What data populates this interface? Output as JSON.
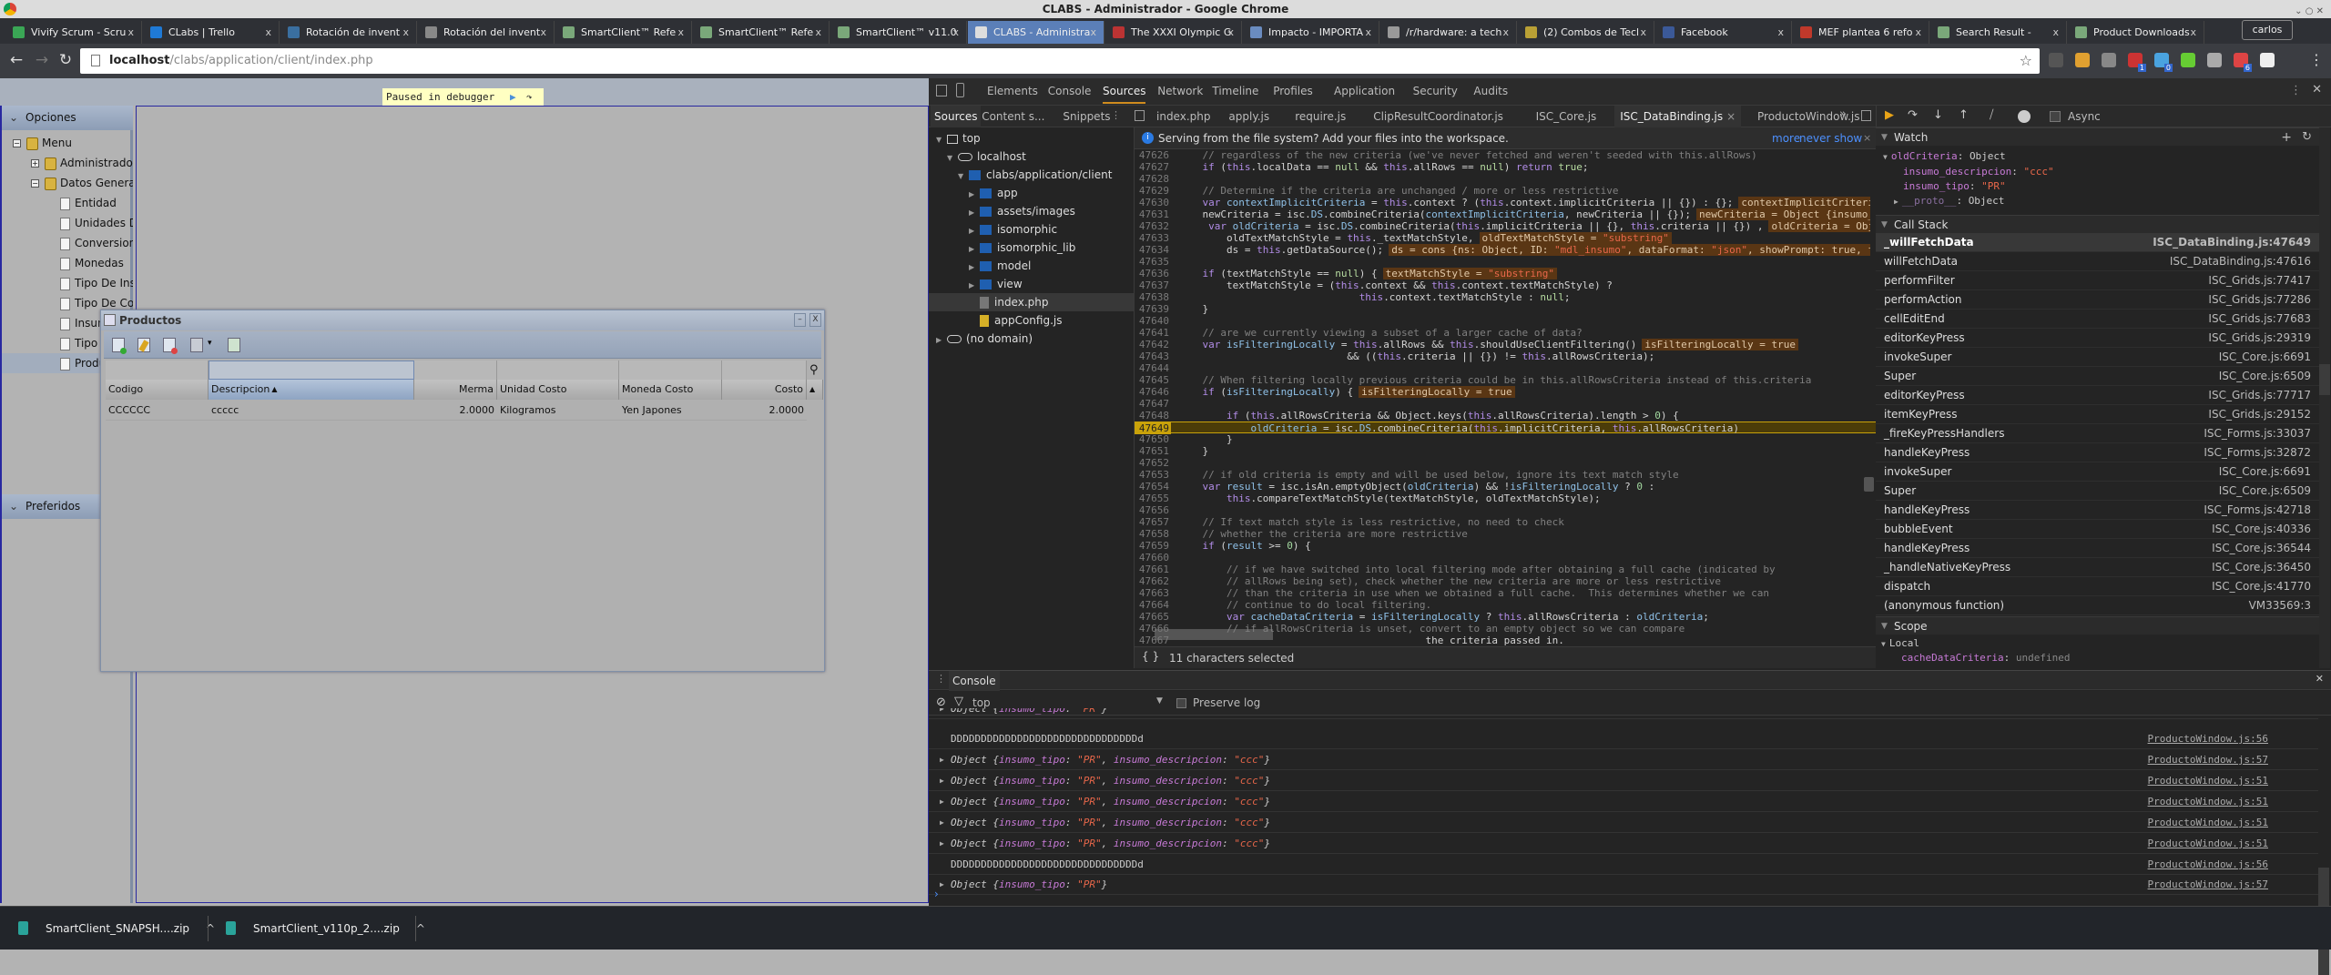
{
  "window_title": "CLABS - Administrador - Google Chrome",
  "browser": {
    "tabs": [
      {
        "label": "Vivify Scrum - Scru",
        "icon": "checkmark-icon",
        "color": "#3aa655"
      },
      {
        "label": "CLabs | Trello",
        "icon": "trello-icon",
        "color": "#1f7ad6"
      },
      {
        "label": "Rotación de invent",
        "icon": "at-icon",
        "color": "#3a6fa0"
      },
      {
        "label": "Rotación del invent",
        "icon": "wikipedia-icon",
        "color": "#888888"
      },
      {
        "label": "SmartClient™ Refe",
        "icon": "smartclient-icon",
        "color": "#7aa87a"
      },
      {
        "label": "SmartClient™ Refe",
        "icon": "smartclient-icon",
        "color": "#7aa87a"
      },
      {
        "label": "SmartClient™ v11.0",
        "icon": "smartclient-icon",
        "color": "#7aa87a"
      },
      {
        "label": "CLABS - Administra",
        "icon": "page-icon",
        "color": "#dddddd",
        "active": true
      },
      {
        "label": "The XXXI Olympic G",
        "icon": "olympic-icon",
        "color": "#b33"
      },
      {
        "label": "Impacto - IMPORTA",
        "icon": "impacto-icon",
        "color": "#6a8cc0"
      },
      {
        "label": "/r/hardware: a tech",
        "icon": "reddit-icon",
        "color": "#999999"
      },
      {
        "label": "(2) Combos de Tecl",
        "icon": "combos-icon",
        "color": "#b9a035"
      },
      {
        "label": "Facebook",
        "icon": "facebook-icon",
        "color": "#3b5998"
      },
      {
        "label": "MEF plantea 6 refo",
        "icon": "mef-icon",
        "color": "#c0392b"
      },
      {
        "label": "Search Result -",
        "icon": "smartclient-icon",
        "color": "#7aa87a",
        "muted": true
      },
      {
        "label": "Product Downloads",
        "icon": "smartclient-icon",
        "color": "#7aa87a"
      }
    ],
    "profile": "carlos",
    "url_host": "localhost",
    "url_path": "/clabs/application/client/index.php",
    "extensions": [
      {
        "icon": "extension-icon",
        "color": "#555"
      },
      {
        "icon": "google-apps-icon",
        "color": "#e0a030"
      },
      {
        "icon": "ghost-icon",
        "color": "#888"
      },
      {
        "icon": "extension-s-icon",
        "color": "#c33",
        "badge": "1"
      },
      {
        "icon": "extension-drop-icon",
        "color": "#4aa3df",
        "badge": "0"
      },
      {
        "icon": "bug-icon",
        "color": "#6c3"
      },
      {
        "icon": "extension-t-icon",
        "color": "#aaa"
      },
      {
        "icon": "gmail-icon",
        "color": "#d44",
        "badge": "6"
      },
      {
        "icon": "jetbrains-icon",
        "color": "#eee"
      }
    ]
  },
  "app": {
    "paused_label": "Paused in debugger",
    "sections": {
      "opciones": "Opciones",
      "preferidos": "Preferidos"
    },
    "tree": [
      {
        "label": "Menu",
        "type": "folder",
        "toggle": "−",
        "level": 0
      },
      {
        "label": "Administrador",
        "type": "folder",
        "toggle": "+",
        "level": 1
      },
      {
        "label": "Datos Generales",
        "type": "folder",
        "toggle": "−",
        "level": 1
      },
      {
        "label": "Entidad",
        "type": "doc",
        "level": 2
      },
      {
        "label": "Unidades De Medida",
        "type": "doc",
        "level": 2
      },
      {
        "label": "Conversion",
        "type": "doc",
        "level": 2
      },
      {
        "label": "Monedas",
        "type": "doc",
        "level": 2
      },
      {
        "label": "Tipo De Insumo",
        "type": "doc",
        "level": 2
      },
      {
        "label": "Tipo De Costo",
        "type": "doc",
        "level": 2
      },
      {
        "label": "Insumos",
        "type": "doc",
        "level": 2
      },
      {
        "label": "Tipo",
        "type": "doc",
        "level": 2
      },
      {
        "label": "Productos",
        "type": "doc",
        "level": 2,
        "selected": true
      }
    ],
    "window": {
      "title": "Productos",
      "columns": [
        "Codigo",
        "Descripcion",
        "Merma",
        "Unidad Costo",
        "Moneda Costo",
        "Costo"
      ],
      "sorted_column": "Descripcion",
      "sort_direction": "ascending",
      "rows": [
        [
          "CCCCCC",
          "ccccc",
          "2.0000",
          "Kilogramos",
          "Yen Japones",
          "2.0000"
        ]
      ]
    }
  },
  "devtools": {
    "tabs": [
      "Elements",
      "Console",
      "Sources",
      "Network",
      "Timeline",
      "Profiles",
      "Application",
      "Security",
      "Audits"
    ],
    "active_tab": "Sources",
    "navigator_tabs": [
      "Sources",
      "Content s...",
      "Snippets"
    ],
    "file_tabs": [
      "index.php",
      "apply.js",
      "require.js",
      "ClipResultCoordinator.js",
      "ISC_Core.js",
      "ISC_DataBinding.js",
      "ProductoWindow.js"
    ],
    "active_file": "ISC_DataBinding.js",
    "infobar": {
      "text": "Serving from the file system? Add your files into the workspace.",
      "more": "more",
      "never_show": "never show"
    },
    "navigator": [
      {
        "label": "top",
        "level": 0,
        "kind": "frame"
      },
      {
        "label": "localhost",
        "level": 1,
        "kind": "cloud"
      },
      {
        "label": "clabs/application/client",
        "level": 2,
        "kind": "folder",
        "open": true
      },
      {
        "label": "app",
        "level": 3,
        "kind": "folder"
      },
      {
        "label": "assets/images",
        "level": 3,
        "kind": "folder"
      },
      {
        "label": "isomorphic",
        "level": 3,
        "kind": "folder"
      },
      {
        "label": "isomorphic_lib",
        "level": 3,
        "kind": "folder"
      },
      {
        "label": "model",
        "level": 3,
        "kind": "folder"
      },
      {
        "label": "view",
        "level": 3,
        "kind": "folder"
      },
      {
        "label": "index.php",
        "level": 3,
        "kind": "file",
        "selected": true
      },
      {
        "label": "appConfig.js",
        "level": 3,
        "kind": "jsfile"
      },
      {
        "label": "(no domain)",
        "level": 0,
        "kind": "cloud"
      }
    ],
    "code": {
      "paused_line": 47649,
      "lines": [
        {
          "n": 47626,
          "t": "    // regardless of the new criteria (we've never fetched and weren't seeded with this.allRows)"
        },
        {
          "n": 47627,
          "t": "    if (this.localData == null && this.allRows == null) return true;"
        },
        {
          "n": 47628,
          "t": ""
        },
        {
          "n": 47629,
          "t": "    // Determine if the criteria are unchanged / more or less restrictive"
        },
        {
          "n": 47630,
          "t": "    var contextImplicitCriteria = this.context ? (this.context.implicitCriteria || {}) : {};",
          "v": "contextImplicitCriteria"
        },
        {
          "n": 47631,
          "t": "    newCriteria = isc.DS.combineCriteria(contextImplicitCriteria, newCriteria || {});",
          "v": "newCriteria = Object {insumo_"
        },
        {
          "n": 47632,
          "t": "     var oldCriteria = isc.DS.combineCriteria(this.implicitCriteria || {}, this.criteria || {}) ,",
          "v": "oldCriteria = Obj"
        },
        {
          "n": 47633,
          "t": "        oldTextMatchStyle = this._textMatchStyle,",
          "v": "oldTextMatchStyle = \"substring\""
        },
        {
          "n": 47634,
          "t": "        ds = this.getDataSource();",
          "v": "ds = cons {ns: Object, ID: \"mdl_insumo\", dataFormat: \"json\", showPrompt: true, f"
        },
        {
          "n": 47635,
          "t": ""
        },
        {
          "n": 47636,
          "t": "    if (textMatchStyle == null) {",
          "v": "textMatchStyle = \"substring\""
        },
        {
          "n": 47637,
          "t": "        textMatchStyle = (this.context && this.context.textMatchStyle) ?"
        },
        {
          "n": 47638,
          "t": "                              this.context.textMatchStyle : null;"
        },
        {
          "n": 47639,
          "t": "    }"
        },
        {
          "n": 47640,
          "t": ""
        },
        {
          "n": 47641,
          "t": "    // are we currently viewing a subset of a larger cache of data?"
        },
        {
          "n": 47642,
          "t": "    var isFilteringLocally = this.allRows && this.shouldUseClientFiltering()",
          "v": "isFilteringLocally = true"
        },
        {
          "n": 47643,
          "t": "                            && ((this.criteria || {}) != this.allRowsCriteria);"
        },
        {
          "n": 47644,
          "t": ""
        },
        {
          "n": 47645,
          "t": "    // When filtering locally previous criteria could be in this.allRowsCriteria instead of this.criteria"
        },
        {
          "n": 47646,
          "t": "    if (isFilteringLocally) {",
          "v": "isFilteringLocally = true"
        },
        {
          "n": 47647,
          "t": ""
        },
        {
          "n": 47648,
          "t": "        if (this.allRowsCriteria && Object.keys(this.allRowsCriteria).length > 0) {"
        },
        {
          "n": 47649,
          "t": "            oldCriteria = isc.DS.combineCriteria(this.implicitCriteria, this.allRowsCriteria)"
        },
        {
          "n": 47650,
          "t": "        }"
        },
        {
          "n": 47651,
          "t": "    }"
        },
        {
          "n": 47652,
          "t": ""
        },
        {
          "n": 47653,
          "t": "    // if old criteria is empty and will be used below, ignore its text match style"
        },
        {
          "n": 47654,
          "t": "    var result = isc.isAn.emptyObject(oldCriteria) && !isFilteringLocally ? 0 :"
        },
        {
          "n": 47655,
          "t": "        this.compareTextMatchStyle(textMatchStyle, oldTextMatchStyle);"
        },
        {
          "n": 47656,
          "t": ""
        },
        {
          "n": 47657,
          "t": "    // If text match style is less restrictive, no need to check"
        },
        {
          "n": 47658,
          "t": "    // whether the criteria are more restrictive"
        },
        {
          "n": 47659,
          "t": "    if (result >= 0) {"
        },
        {
          "n": 47660,
          "t": ""
        },
        {
          "n": 47661,
          "t": "        // if we have switched into local filtering mode after obtaining a full cache (indicated by"
        },
        {
          "n": 47662,
          "t": "        // allRows being set), check whether the new criteria are more or less restrictive"
        },
        {
          "n": 47663,
          "t": "        // than the criteria in use when we obtained a full cache.  This determines whether we can"
        },
        {
          "n": 47664,
          "t": "        // continue to do local filtering."
        },
        {
          "n": 47665,
          "t": "        var cacheDataCriteria = isFilteringLocally ? this.allRowsCriteria : oldCriteria;"
        },
        {
          "n": 47666,
          "t": "        // if allRowsCriteria is unset, convert to an empty object so we can compare"
        },
        {
          "n": 47667,
          "t": "                                         the criteria passed in."
        }
      ]
    },
    "status": "11 characters selected",
    "debugger": {
      "async_label": "Async",
      "watch_title": "Watch",
      "watch": {
        "name": "oldCriteria",
        "type": "Object",
        "props": [
          {
            "k": "insumo_descripcion",
            "v": "\"ccc\""
          },
          {
            "k": "insumo_tipo",
            "v": "\"PR\""
          }
        ],
        "proto": "__proto__",
        "proto_type": "Object"
      },
      "callstack_title": "Call Stack",
      "callstack": [
        {
          "fn": "_willFetchData",
          "loc": "ISC_DataBinding.js:47649"
        },
        {
          "fn": "willFetchData",
          "loc": "ISC_DataBinding.js:47616"
        },
        {
          "fn": "performFilter",
          "loc": "ISC_Grids.js:77417"
        },
        {
          "fn": "performAction",
          "loc": "ISC_Grids.js:77286"
        },
        {
          "fn": "cellEditEnd",
          "loc": "ISC_Grids.js:77683"
        },
        {
          "fn": "editorKeyPress",
          "loc": "ISC_Grids.js:29319"
        },
        {
          "fn": "invokeSuper",
          "loc": "ISC_Core.js:6691"
        },
        {
          "fn": "Super",
          "loc": "ISC_Core.js:6509"
        },
        {
          "fn": "editorKeyPress",
          "loc": "ISC_Grids.js:77717"
        },
        {
          "fn": "itemKeyPress",
          "loc": "ISC_Grids.js:29152"
        },
        {
          "fn": "_fireKeyPressHandlers",
          "loc": "ISC_Forms.js:33037"
        },
        {
          "fn": "handleKeyPress",
          "loc": "ISC_Forms.js:32872"
        },
        {
          "fn": "invokeSuper",
          "loc": "ISC_Core.js:6691"
        },
        {
          "fn": "Super",
          "loc": "ISC_Core.js:6509"
        },
        {
          "fn": "handleKeyPress",
          "loc": "ISC_Forms.js:42718"
        },
        {
          "fn": "bubbleEvent",
          "loc": "ISC_Core.js:40336"
        },
        {
          "fn": "handleKeyPress",
          "loc": "ISC_Core.js:36544"
        },
        {
          "fn": "_handleNativeKeyPress",
          "loc": "ISC_Core.js:36450"
        },
        {
          "fn": "dispatch",
          "loc": "ISC_Core.js:41770"
        },
        {
          "fn": "(anonymous function)",
          "loc": "VM33569:3"
        }
      ],
      "scope_title": "Scope",
      "local_title": "Local",
      "local": [
        {
          "k": "cacheDataCriteria",
          "v": "undefined"
        }
      ]
    },
    "console": {
      "tab": "Console",
      "context": "top",
      "preserve_log": "Preserve log",
      "messages": [
        {
          "kind": "object",
          "props": [
            [
              "insumo_tipo",
              "\"PR\""
            ]
          ],
          "src": "ProductoWindow.js:56",
          "partial": true
        },
        {
          "kind": "text",
          "text": "DDDDDDDDDDDDDDDDDDDDDDDDDDDDDDDd",
          "src": "ProductoWindow.js:56"
        },
        {
          "kind": "object",
          "props": [
            [
              "insumo_tipo",
              "\"PR\""
            ],
            [
              "insumo_descripcion",
              "\"ccc\""
            ]
          ],
          "src": "ProductoWindow.js:57"
        },
        {
          "kind": "object",
          "props": [
            [
              "insumo_tipo",
              "\"PR\""
            ],
            [
              "insumo_descripcion",
              "\"ccc\""
            ]
          ],
          "src": "ProductoWindow.js:51"
        },
        {
          "kind": "object",
          "props": [
            [
              "insumo_tipo",
              "\"PR\""
            ],
            [
              "insumo_descripcion",
              "\"ccc\""
            ]
          ],
          "src": "ProductoWindow.js:51"
        },
        {
          "kind": "object",
          "props": [
            [
              "insumo_tipo",
              "\"PR\""
            ],
            [
              "insumo_descripcion",
              "\"ccc\""
            ]
          ],
          "src": "ProductoWindow.js:51"
        },
        {
          "kind": "object",
          "props": [
            [
              "insumo_tipo",
              "\"PR\""
            ],
            [
              "insumo_descripcion",
              "\"ccc\""
            ]
          ],
          "src": "ProductoWindow.js:51"
        },
        {
          "kind": "text",
          "text": "DDDDDDDDDDDDDDDDDDDDDDDDDDDDDDDd",
          "src": "ProductoWindow.js:56"
        },
        {
          "kind": "object",
          "props": [
            [
              "insumo_tipo",
              "\"PR\""
            ]
          ],
          "src": "ProductoWindow.js:57"
        }
      ]
    }
  },
  "downloads": [
    {
      "name": "SmartClient_SNAPSH....zip"
    },
    {
      "name": "SmartClient_v110p_2....zip"
    }
  ]
}
